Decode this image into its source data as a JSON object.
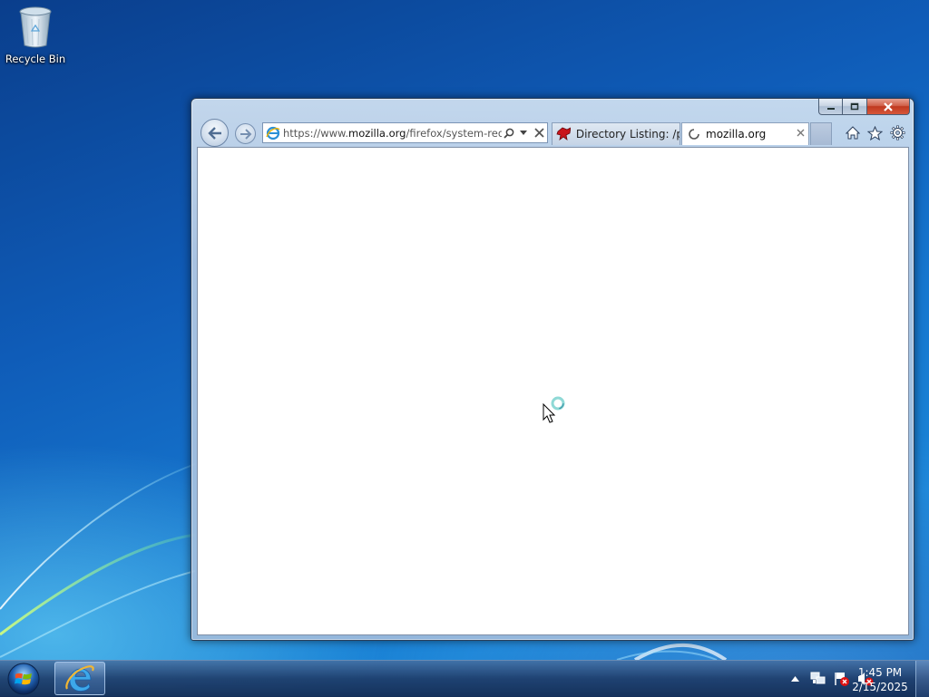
{
  "desktop": {
    "icons": [
      {
        "label": "Recycle Bin",
        "icon": "recycle-bin-icon"
      }
    ]
  },
  "browser": {
    "address": {
      "scheme": "https://www.",
      "domain": "mozilla.org",
      "path": "/firefox/system-requ"
    },
    "tabs": [
      {
        "title": "Directory Listing: /p...",
        "icon": "directory-listing-favicon",
        "active": false
      },
      {
        "title": "mozilla.org",
        "icon": "loading-spinner-icon",
        "active": true
      }
    ]
  },
  "taskbar": {
    "clock": {
      "time": "1:45 PM",
      "date": "2/15/2025"
    }
  }
}
